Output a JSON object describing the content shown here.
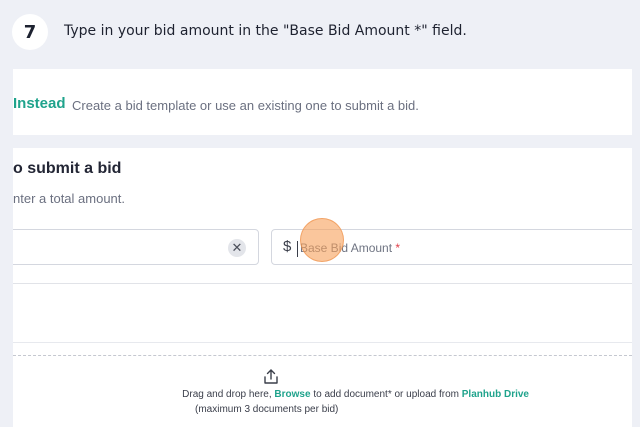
{
  "step": {
    "number": "7",
    "instruction": "Type in your bid amount in the \"Base Bid Amount *\" field."
  },
  "template_section": {
    "title": "Instead",
    "description": "Create a bid template or use an existing one to submit a bid."
  },
  "bid_section": {
    "title": "o submit a bid",
    "description": "nter a total amount.",
    "clear_icon": "close-icon",
    "currency_symbol": "$",
    "base_bid_placeholder": "Base Bid Amount",
    "required_marker": "*"
  },
  "dropzone": {
    "icon": "upload-icon",
    "text_prefix": "Drag and drop here, ",
    "browse_label": "Browse",
    "text_middle": " to add document* or upload from ",
    "drive_label": "Planhub Drive",
    "note": "(maximum 3 documents per bid)"
  },
  "colors": {
    "accent": "#1fa38c",
    "required": "#e0404a",
    "highlight": "#f6a05a"
  }
}
